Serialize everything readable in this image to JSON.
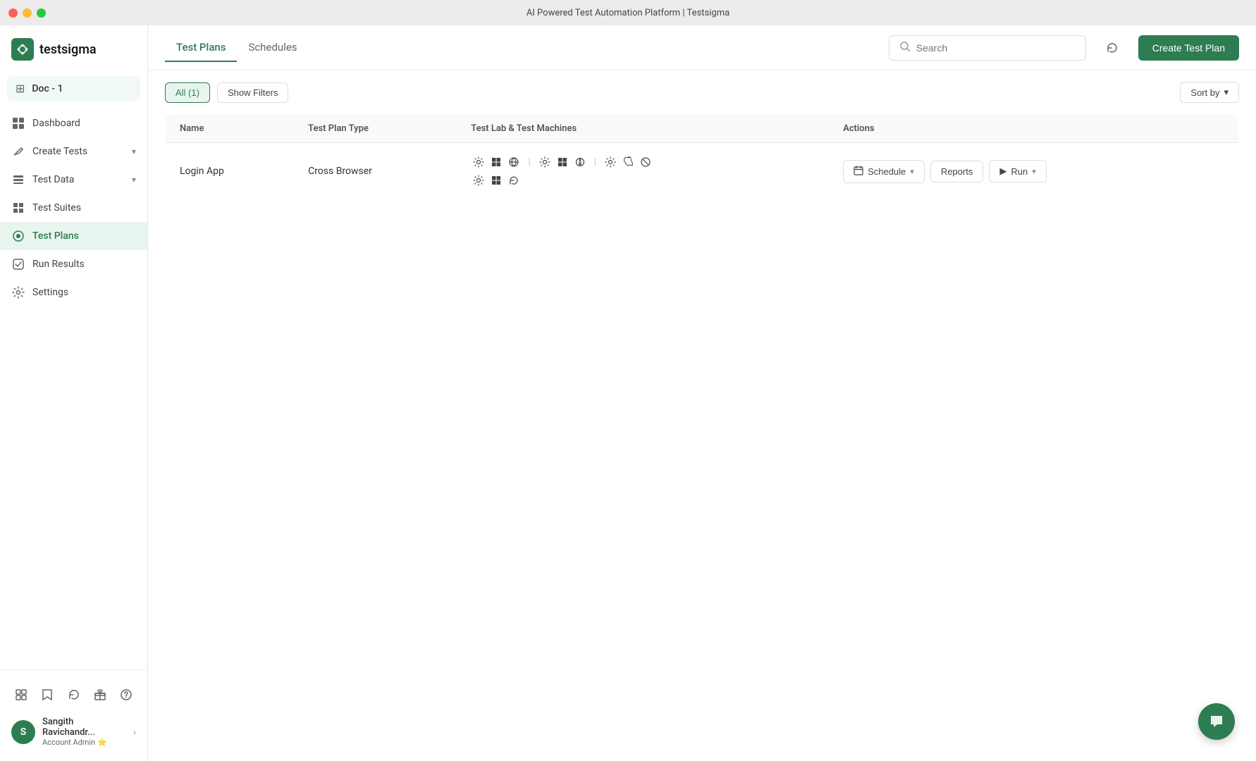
{
  "titlebar": {
    "title": "AI Powered Test Automation Platform | Testsigma"
  },
  "sidebar": {
    "logo": {
      "text": "testsigma"
    },
    "doc": {
      "label": "Doc - 1"
    },
    "nav": [
      {
        "id": "dashboard",
        "label": "Dashboard",
        "icon": "⊞",
        "active": false
      },
      {
        "id": "create-tests",
        "label": "Create Tests",
        "icon": "✎",
        "active": false,
        "hasArrow": true
      },
      {
        "id": "test-data",
        "label": "Test Data",
        "icon": "⊟",
        "active": false,
        "hasArrow": true
      },
      {
        "id": "test-suites",
        "label": "Test Suites",
        "icon": "⊞",
        "active": false
      },
      {
        "id": "test-plans",
        "label": "Test Plans",
        "icon": "◎",
        "active": true
      },
      {
        "id": "run-results",
        "label": "Run Results",
        "icon": "◈",
        "active": false
      },
      {
        "id": "settings",
        "label": "Settings",
        "icon": "⚙",
        "active": false
      }
    ],
    "bottomIcons": [
      "⊞",
      "☆",
      "↺",
      "⊟",
      "?"
    ],
    "user": {
      "initial": "S",
      "name": "Sangith Ravichandr...",
      "role": "Account Admin",
      "roleEmoji": "⭐"
    }
  },
  "header": {
    "tabs": [
      {
        "label": "Test Plans",
        "active": true
      },
      {
        "label": "Schedules",
        "active": false
      }
    ],
    "search": {
      "placeholder": "Search"
    },
    "createButton": "Create Test Plan"
  },
  "toolbar": {
    "allCount": "All (1)",
    "showFilters": "Show Filters",
    "sortBy": "Sort by"
  },
  "table": {
    "columns": [
      "Name",
      "Test Plan Type",
      "Test Lab & Test Machines",
      "Actions"
    ],
    "rows": [
      {
        "name": "Login App",
        "type": "Cross Browser",
        "machines": [
          [
            "⚙",
            "⊞",
            "↺"
          ],
          [
            "⚙",
            "⊞",
            "⊟",
            "↺"
          ],
          [
            "⚙",
            "⊞",
            "⬤"
          ],
          [
            "⚙",
            "⊞",
            "↺"
          ]
        ],
        "actions": {
          "schedule": "Schedule",
          "reports": "Reports",
          "run": "Run"
        }
      }
    ]
  },
  "chat": {
    "icon": "💬"
  }
}
